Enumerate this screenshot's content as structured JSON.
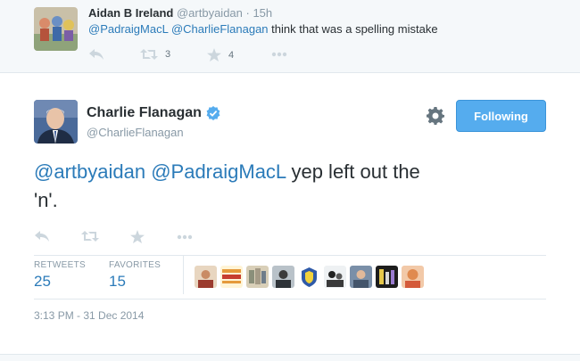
{
  "reply": {
    "name": "Aidan B Ireland",
    "meta": "@artbyaidan · 15h",
    "mention1": "@PadraigMacL",
    "mention2": "@CharlieFlanagan",
    "text_rest": " think that was a spelling mistake",
    "retweets": "3",
    "favorites": "4"
  },
  "tweet": {
    "name": "Charlie Flanagan",
    "handle": "@CharlieFlanagan",
    "follow_label": "Following",
    "mention1": "@artbyaidan",
    "mention2": "@PadraigMacL",
    "text_rest": " yep left out the 'n'.",
    "retweets_label": "RETWEETS",
    "retweets": "25",
    "favorites_label": "FAVORITES",
    "favorites": "15",
    "timestamp": "3:13 PM - 31 Dec 2014"
  },
  "colors": {
    "link": "#2b7bb9",
    "follow_bg": "#55acee",
    "muted": "#8899a6"
  },
  "icons": [
    "reply-icon",
    "retweet-icon",
    "favorite-icon",
    "more-icon",
    "gear-icon",
    "verified-badge-icon"
  ]
}
